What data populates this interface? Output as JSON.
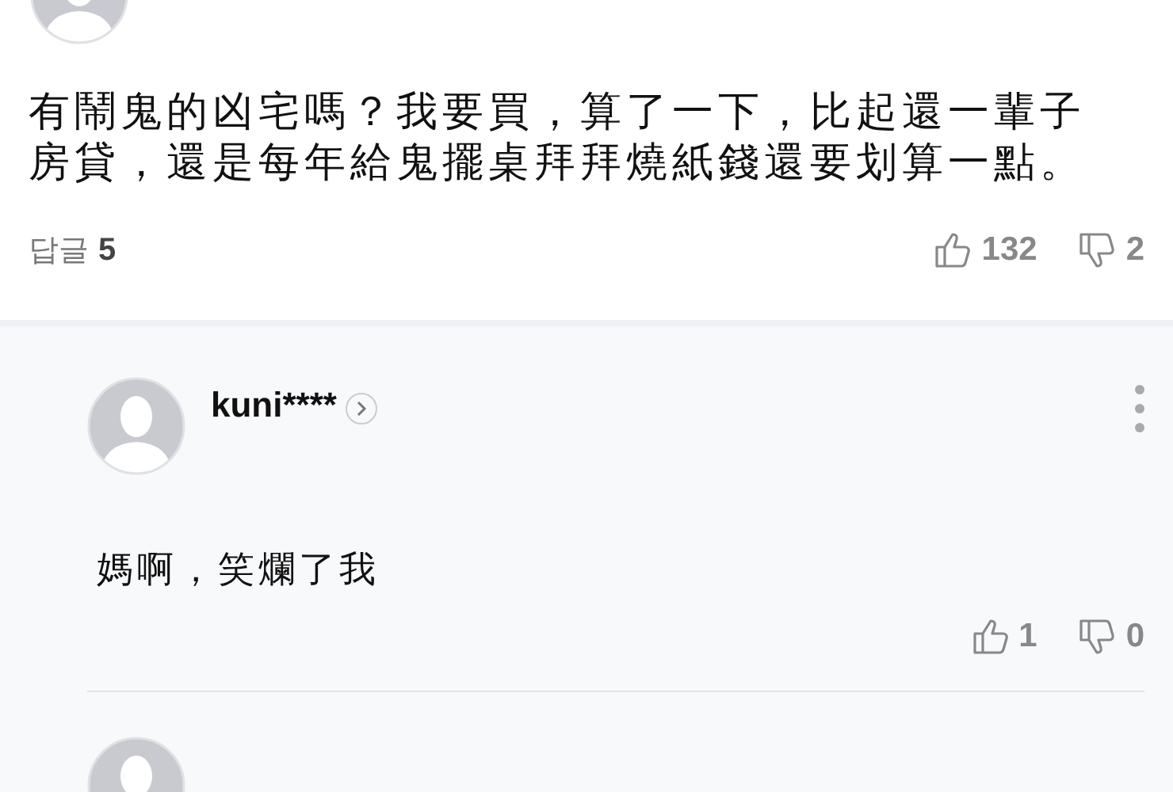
{
  "comment": {
    "text": "有鬧鬼的凶宅嗎？我要買，算了一下，比起還一輩子房貸，還是每年給鬼擺桌拜拜燒紙錢還要划算一點。",
    "reply_label": "답글",
    "reply_count": "5",
    "likes": "132",
    "dislikes": "2"
  },
  "replies": [
    {
      "author": "kuni****",
      "text": "媽啊，笑爛了我",
      "likes": "1",
      "dislikes": "0"
    }
  ]
}
